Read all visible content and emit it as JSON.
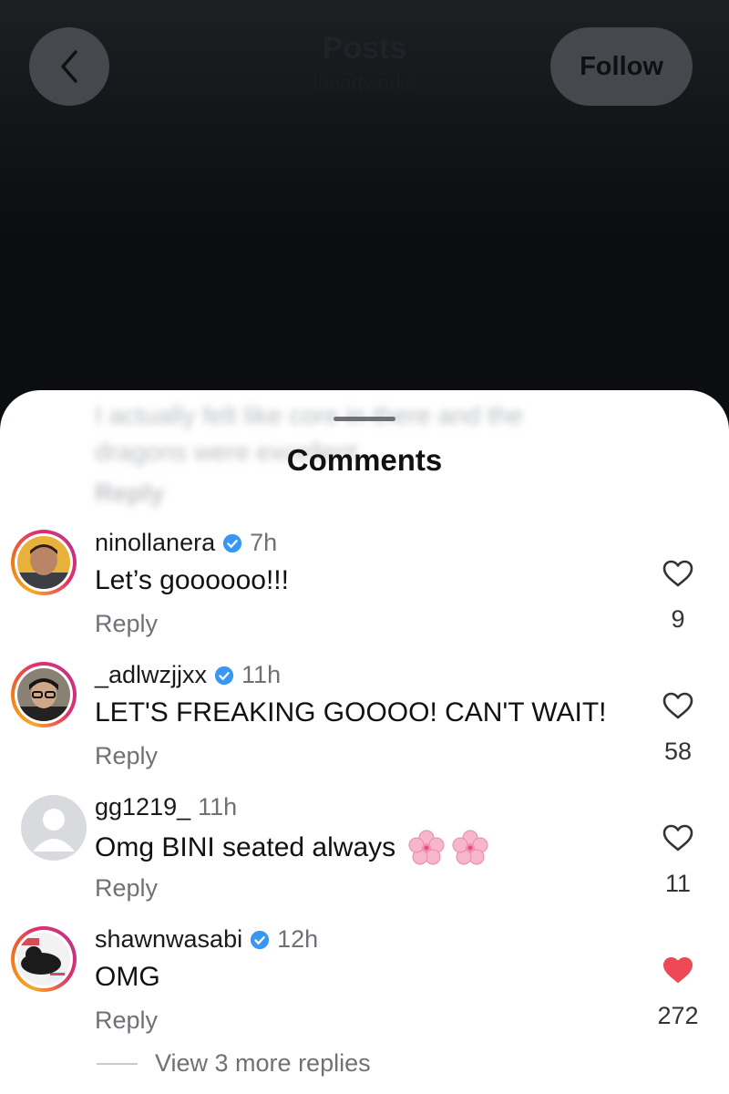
{
  "header": {
    "back_icon": "chevron-left-icon",
    "title": "Posts",
    "subtitle": "iheartworks",
    "follow_label": "Follow"
  },
  "sheet": {
    "title": "Comments",
    "partial_text_line1": "I actually felt like core in there and the",
    "partial_text_line2": "dragons were excellent",
    "partial_reply": "Reply"
  },
  "comments": [
    {
      "username": "ninollanera",
      "verified": true,
      "time": "7h",
      "text": "Let’s goooooo!!!",
      "reply_label": "Reply",
      "likes": "9",
      "liked": false,
      "avatar_ring": true
    },
    {
      "username": "_adlwzjjxx",
      "verified": true,
      "time": "11h",
      "text": "LET'S FREAKING GOOOO! CAN'T WAIT!",
      "reply_label": "Reply",
      "likes": "58",
      "liked": false,
      "avatar_ring": true
    },
    {
      "username": "gg1219_",
      "verified": false,
      "time": "11h",
      "text": "Omg BINI seated always",
      "emoji": "cherry-blossom-icon",
      "reply_label": "Reply",
      "likes": "11",
      "liked": false,
      "avatar_ring": false
    },
    {
      "username": "shawnwasabi",
      "verified": true,
      "time": "12h",
      "text": "OMG",
      "reply_label": "Reply",
      "likes": "272",
      "liked": true,
      "avatar_ring": true
    }
  ],
  "view_more_replies": "View 3 more replies",
  "colors": {
    "verified_blue": "#3897f0",
    "liked_red": "#ed4956",
    "secondary_text": "#6e7176",
    "story_ring": [
      "#f9a825",
      "#e1306c",
      "#c13584"
    ]
  }
}
